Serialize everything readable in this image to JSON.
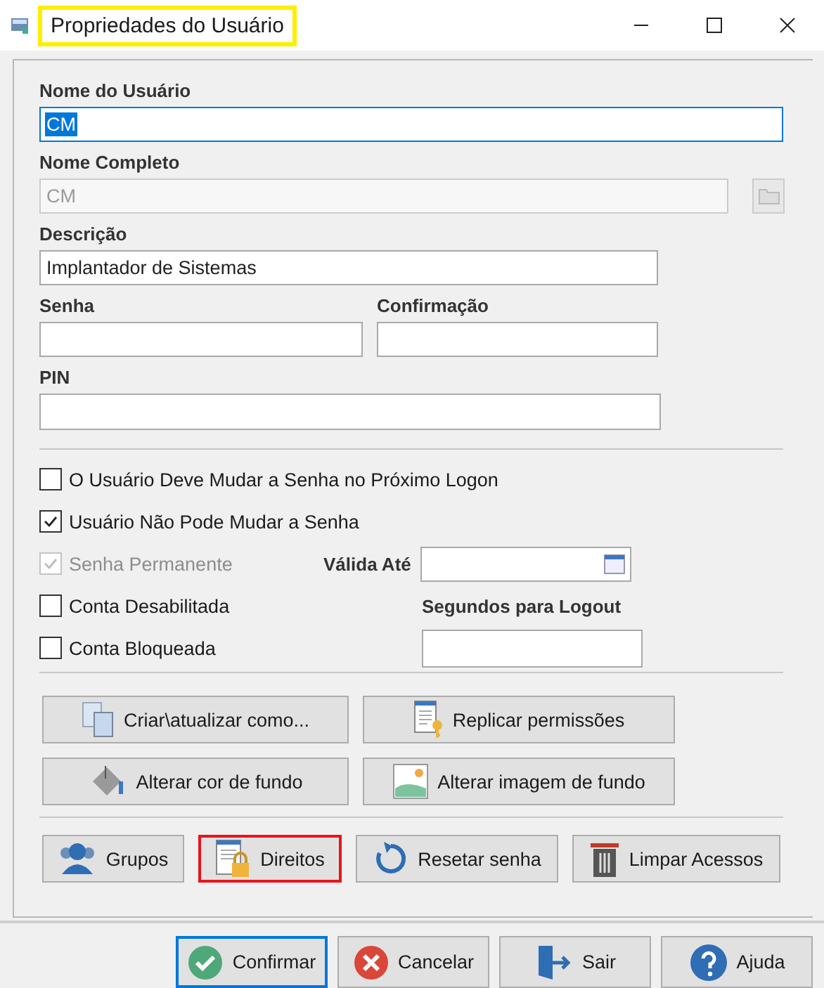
{
  "window": {
    "title": "Propriedades do Usuário",
    "highlighted": true
  },
  "user_name": {
    "label": "Nome do Usuário",
    "value": "CM",
    "selected": true
  },
  "full_name": {
    "label": "Nome Completo",
    "value": "CM",
    "disabled": true
  },
  "description": {
    "label": "Descrição",
    "value": "Implantador de Sistemas"
  },
  "password": {
    "label": "Senha"
  },
  "confirmation": {
    "label": "Confirmação"
  },
  "pin": {
    "label": "PIN"
  },
  "options": [
    {
      "label": "O Usuário Deve Mudar a Senha no Próximo Logon",
      "checked": false,
      "disabled": false
    },
    {
      "label": "Usuário Não Pode Mudar a Senha",
      "checked": true,
      "disabled": false
    },
    {
      "label": "Senha Permanente",
      "checked": true,
      "disabled": true
    },
    {
      "label": "Conta Desabilitada",
      "checked": false,
      "disabled": false
    },
    {
      "label": "Conta Bloqueada",
      "checked": false,
      "disabled": false
    }
  ],
  "valid_until": {
    "label": "Válida Até"
  },
  "logout_seconds": {
    "label": "Segundos para Logout"
  },
  "actions": [
    {
      "label": "Criar\\atualizar como..."
    },
    {
      "label": "Replicar permissões"
    },
    {
      "label": "Alterar cor de fundo"
    },
    {
      "label": "Alterar imagem de fundo"
    }
  ],
  "rights_buttons": [
    {
      "label": "Grupos",
      "highlighted": false
    },
    {
      "label": "Direitos",
      "highlighted": true
    },
    {
      "label": "Resetar senha",
      "highlighted": false
    },
    {
      "label": "Limpar Acessos",
      "highlighted": false
    }
  ],
  "dialog_buttons": [
    {
      "label": "Confirmar",
      "focused": true
    },
    {
      "label": "Cancelar",
      "focused": false
    },
    {
      "label": "Sair",
      "focused": false
    },
    {
      "label": "Ajuda",
      "focused": false
    }
  ]
}
